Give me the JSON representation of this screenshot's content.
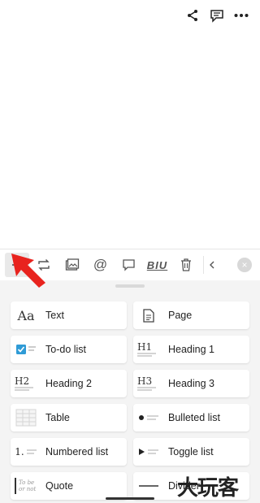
{
  "header": {
    "icons": [
      "share-icon",
      "comment-icon",
      "more-icon"
    ]
  },
  "toolbar": {
    "buttons": [
      "add-block",
      "turn-into",
      "image",
      "mention",
      "comment",
      "text-format",
      "delete",
      "more"
    ],
    "format_label": "BIU",
    "mention_label": "@",
    "close_label": "×"
  },
  "blocks": [
    {
      "label": "Text",
      "icon": "text-icon",
      "glyph": "Aa"
    },
    {
      "label": "Page",
      "icon": "page-icon"
    },
    {
      "label": "To-do list",
      "icon": "todo-icon"
    },
    {
      "label": "Heading 1",
      "icon": "heading1-icon",
      "glyph": "H1"
    },
    {
      "label": "Heading 2",
      "icon": "heading2-icon",
      "glyph": "H2"
    },
    {
      "label": "Heading 3",
      "icon": "heading3-icon",
      "glyph": "H3"
    },
    {
      "label": "Table",
      "icon": "table-icon"
    },
    {
      "label": "Bulleted list",
      "icon": "bulleted-list-icon"
    },
    {
      "label": "Numbered list",
      "icon": "numbered-list-icon",
      "glyph": "1."
    },
    {
      "label": "Toggle list",
      "icon": "toggle-list-icon"
    },
    {
      "label": "Quote",
      "icon": "quote-icon",
      "glyph": "To be or not"
    },
    {
      "label": "Divider",
      "icon": "divider-icon"
    }
  ],
  "watermark": "大玩客",
  "colors": {
    "accent": "#2f9bd6",
    "arrow": "#e8231e"
  }
}
